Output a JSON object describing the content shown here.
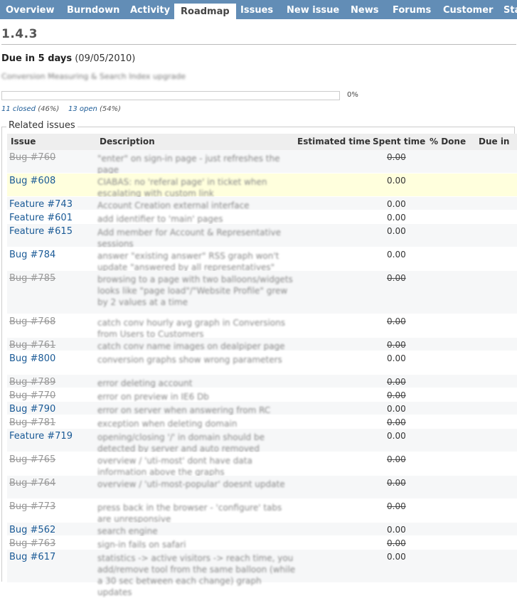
{
  "tabs": [
    {
      "label": "Overview",
      "active": false
    },
    {
      "label": "Burndown",
      "active": false
    },
    {
      "label": "Activity",
      "active": false
    },
    {
      "label": "Roadmap",
      "active": true
    },
    {
      "label": "Issues",
      "active": false
    },
    {
      "label": "New issue",
      "active": false
    },
    {
      "label": "News",
      "active": false
    },
    {
      "label": "Forums",
      "active": false
    },
    {
      "label": "Customer",
      "active": false
    },
    {
      "label": "Sta",
      "active": false
    }
  ],
  "version": {
    "title": "1.4.3",
    "due_label": "Due in 5 days",
    "due_date": "(09/05/2010)",
    "description": "Conversion Measuring & Search Index upgrade",
    "progress_percent": 0,
    "progress_label": "0%",
    "closed_link": "11 closed",
    "closed_pct": "(46%)",
    "open_link": "13 open",
    "open_pct": "(54%)"
  },
  "related": {
    "legend": "Related issues",
    "headers": {
      "issue": "Issue",
      "description": "Description",
      "estimated": "Estimated time",
      "spent": "Spent time",
      "done": "% Done",
      "due": "Due in"
    },
    "rows": [
      {
        "id": "Bug #760",
        "closed": true,
        "desc": "\"enter\" on sign-in page - just refreshes the page",
        "spent": "0.00"
      },
      {
        "id": "Bug #608",
        "closed": false,
        "desc": "CIABAS: no 'referal page' in ticket when escalating with custom link",
        "spent": "0.00",
        "highlight": true
      },
      {
        "id": "Feature #743",
        "closed": false,
        "desc": "Account Creation external interface",
        "spent": "0.00"
      },
      {
        "id": "Feature #601",
        "closed": false,
        "desc": "add identifier to 'main' pages",
        "spent": "0.00"
      },
      {
        "id": "Feature #615",
        "closed": false,
        "desc": "Add member for Account & Representative sessions",
        "spent": "0.00"
      },
      {
        "id": "Bug #784",
        "closed": false,
        "desc": "answer \"existing answer\" RSS graph won't update \"answered by all representatives\"",
        "spent": "0.00"
      },
      {
        "id": "Bug #785",
        "closed": true,
        "desc": "browsing to a page with two balloons/widgets looks like \"page load\"/\"Website Profile\" grew by 2 values at a time",
        "spent": "0.00"
      },
      {
        "id": "Bug #768",
        "closed": true,
        "desc": "catch conv hourly avg graph in Conversions from Users to Customers",
        "spent": "0.00"
      },
      {
        "id": "Bug #761",
        "closed": true,
        "desc": "catch conv name images on dealpiper page",
        "spent": "0.00"
      },
      {
        "id": "Bug #800",
        "closed": false,
        "desc": "conversion graphs show wrong parameters",
        "spent": "0.00"
      },
      {
        "id": "Bug #789",
        "closed": true,
        "desc": "error deleting account",
        "spent": "0.00"
      },
      {
        "id": "Bug #770",
        "closed": true,
        "desc": "error on preview in IE6 Db",
        "spent": "0.00"
      },
      {
        "id": "Bug #790",
        "closed": false,
        "desc": "error on server when answering from RC",
        "spent": "0.00"
      },
      {
        "id": "Bug #781",
        "closed": true,
        "desc": "exception when deleting domain",
        "spent": "0.00"
      },
      {
        "id": "Feature #719",
        "closed": false,
        "desc": "opening/closing '/' in domain should be detected by server and auto removed",
        "spent": "0.00"
      },
      {
        "id": "Bug #765",
        "closed": true,
        "desc": "overview / 'uti-most' dont have data information above the graphs",
        "spent": "0.00"
      },
      {
        "id": "Bug #764",
        "closed": true,
        "desc": "overview / 'uti-most-popular' doesnt update",
        "spent": "0.00"
      },
      {
        "id": "Bug #773",
        "closed": true,
        "desc": "press back in the browser - 'configure' tabs are unresponsive",
        "spent": "0.00"
      },
      {
        "id": "Bug #562",
        "closed": false,
        "desc": "search engine",
        "spent": "0.00"
      },
      {
        "id": "Bug #763",
        "closed": true,
        "desc": "sign-in fails on safari",
        "spent": "0.00"
      },
      {
        "id": "Bug #617",
        "closed": false,
        "desc": "statistics -> active visitors -> reach time, you add/remove tool from the same balloon (while a 30 sec between each change) graph updates",
        "spent": "0.00"
      }
    ]
  }
}
